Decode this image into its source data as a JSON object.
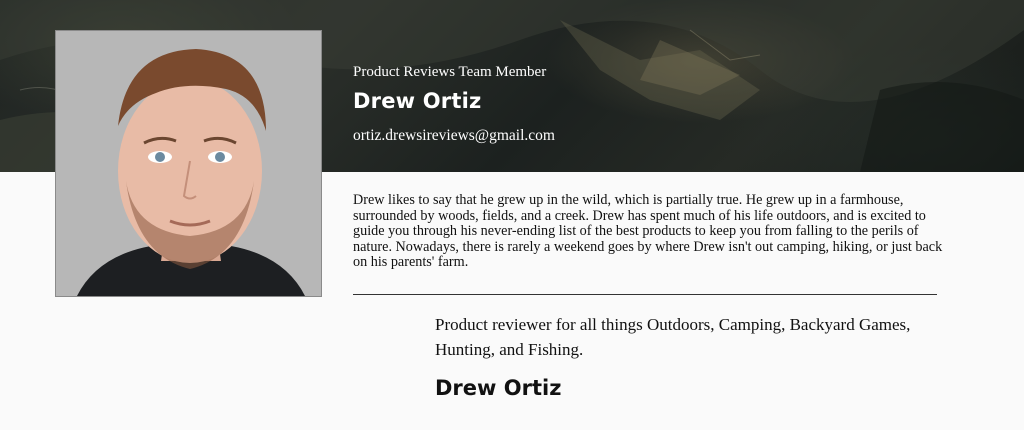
{
  "profile": {
    "role_label": "Product Reviews Team Member",
    "name": "Drew Ortiz",
    "email": "ortiz.drewsireviews@gmail.com",
    "bio": "Drew likes to say that he grew up in the wild, which is partially true. He grew up in a farmhouse, surrounded by woods, fields, and a creek. Drew has spent much of his life outdoors, and is excited to guide you through his never-ending list of the best products to keep you from falling to the perils of nature. Nowadays, there is rarely a weekend goes by where Drew isn't out camping, hiking, or just back on his parents' farm.",
    "tagline": "Product reviewer for all things Outdoors, Camping, Backyard Games, Hunting, and Fishing.",
    "footer_name": "Drew Ortiz"
  },
  "colors": {
    "hero_dark": "#1f2422",
    "photo_background": "#b7b7b7",
    "text_light": "#ffffff",
    "text_dark": "#111111"
  },
  "icons": {
    "hero_background": "mountain-landscape-image",
    "portrait": "person-portrait-image"
  }
}
